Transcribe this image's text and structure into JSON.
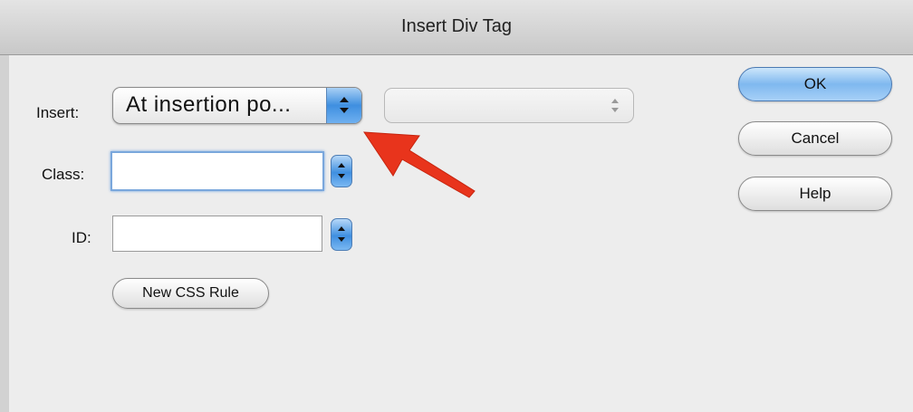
{
  "dialog": {
    "title": "Insert Div Tag"
  },
  "form": {
    "insert_label": "Insert:",
    "insert_value": "At insertion po...",
    "class_label": "Class:",
    "class_value": "",
    "id_label": "ID:",
    "id_value": "",
    "new_css_rule_label": "New CSS Rule"
  },
  "buttons": {
    "ok": "OK",
    "cancel": "Cancel",
    "help": "Help"
  },
  "colors": {
    "annotation_arrow": "#e8341c",
    "default_button": "#7fb8ef",
    "focus_ring": "#7aa7dc"
  },
  "icons": {
    "popup_arrows": "up-down-arrows-icon",
    "annotation": "red-arrow-icon"
  }
}
